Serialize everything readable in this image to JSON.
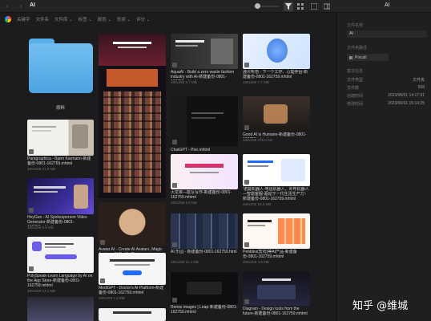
{
  "window": {
    "title": "AI",
    "right_title": "AI"
  },
  "toolbar": {
    "nav": "‹ ›",
    "icons": [
      "filter-icon",
      "grid-icon",
      "list-icon",
      "panel-icon",
      "more-icon"
    ],
    "zoom_level": 0.15
  },
  "filters": [
    "关键字",
    "文件名",
    "文件库 ⌄",
    "标签 ⌄",
    "颜色 ⌄",
    "形状 ⌄",
    "评分 ⌄"
  ],
  "folder": {
    "label": "原料"
  },
  "items": [
    {
      "caption": "Paragraphica - Bjørn Karmann-新建备份-0801-162759.mhtml",
      "sub": "480x258  21.8 MB"
    },
    {
      "caption": "HeyGen - AI Spokesperson Video Generator-新建备份-0801-162759.mhtml",
      "sub": "480x258  6.8 MB"
    },
    {
      "caption": "PolySpeak-Learn Language by AI on the App Store-新建备份-0801-162759.mhtml",
      "sub": "480x258  13.1 MB"
    },
    {
      "caption": "Avatar AI - Create AI Avatars, Magic Avatars, AI Profile Pictures",
      "sub": "1024x11638  3.8 MB"
    },
    {
      "caption": "MediGPT - Doctor's AI Platform-新建备份-0801-162759.mhtml",
      "sub": "480x258  1.2 MB"
    },
    {
      "caption": "AquaAI - Build a zero waste fashion industry with AI-新建备份-0801-162759.mhtml",
      "sub": "480x258  5.7 MB"
    },
    {
      "caption": "ChatGPT - Poe.mhtml",
      "sub": "480x258  145.3 KB"
    },
    {
      "caption": "火龙果—能写写作-新建备份-0801-162759.mhtml",
      "sub": "480x258  5.8 MB"
    },
    {
      "caption": "AI 乐园 - 新建备份-0801-162759.html",
      "sub": "480x258  11.4 MB"
    },
    {
      "caption": "Remio images | Leap-新建备份-0801-162759.mhtml",
      "sub": "480x258  ..."
    },
    {
      "caption": "通义听悟 - 下一个工作、心理伴侣-新建备份-0801-162759.mhtml",
      "sub": "480x258  7.7 MB"
    },
    {
      "caption": "Good AI is Humane-新建备份-0801-162759.mhtml",
      "sub": "480x258  475.6 KB"
    },
    {
      "caption": "'诺曼机器人-电话机器人，外呼机器人—智能客服-驱动下一代生活生产力'-新建备份-0801-162759.mhtml",
      "sub": "480x258  15.3 MB"
    },
    {
      "caption": "Pebbles(宏石)等AI产品-新建备份-0801-162759.mhtml",
      "sub": "480x258  4.8 MB"
    },
    {
      "caption": "Diagram - Design tools from the future-新建备份-0801-162759.mhtml",
      "sub": ""
    }
  ],
  "panel": {
    "labels": [
      "文件名称",
      "AI",
      "文件夹路径",
      "Pixcall",
      "基本信息"
    ],
    "rows": [
      {
        "label": "文件类型",
        "value": "文件夹"
      },
      {
        "label": "文件数",
        "value": "558"
      },
      {
        "label": "创建时间",
        "value": "2023/06/01 14:17:31"
      },
      {
        "label": "修改时间",
        "value": "2023/06/01 15:14:25"
      }
    ]
  },
  "watermark": "知乎 @维城"
}
